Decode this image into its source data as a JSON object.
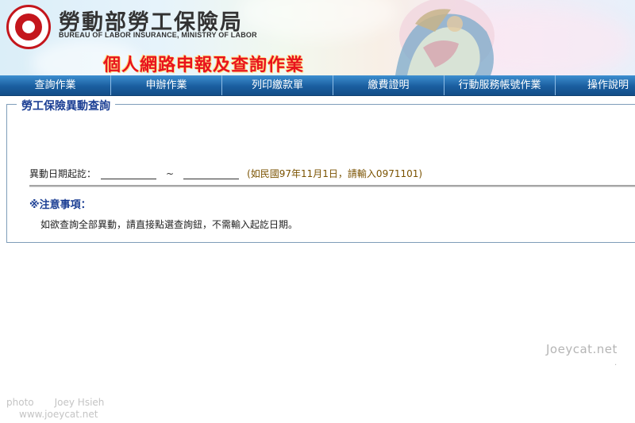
{
  "header": {
    "org_title": "勞動部勞工保險局",
    "org_subtitle": "BUREAU OF LABOR INSURANCE, MINISTRY OF LABOR",
    "service_title": "個人網路申報及查詢作業",
    "brand_color": "#c4161c",
    "service_title_color": "#e8131d"
  },
  "nav": {
    "items": [
      {
        "label": "查詢作業"
      },
      {
        "label": "申辦作業"
      },
      {
        "label": "列印繳款單"
      },
      {
        "label": "繳費證明"
      },
      {
        "label": "行動服務帳號作業"
      },
      {
        "label": "操作說明"
      }
    ],
    "background_color": "#1a5e9f"
  },
  "panel": {
    "legend": "勞工保險異動查詢",
    "query_label": "異動日期起訖：",
    "start_date_value": "",
    "end_date_value": "",
    "range_separator": "~",
    "hint": "(如民國97年11月1日，請輸入0971101)",
    "notice_title": "※注意事項：",
    "notice_text": "如欲查詢全部異動，請直接點選查詢鈕，不需輸入起訖日期。"
  },
  "watermark": {
    "site": "Joeycat.net",
    "dot": ".",
    "photo_label": "photo",
    "photographer": "Joey Hsieh",
    "url": "www.joeycat.net"
  }
}
